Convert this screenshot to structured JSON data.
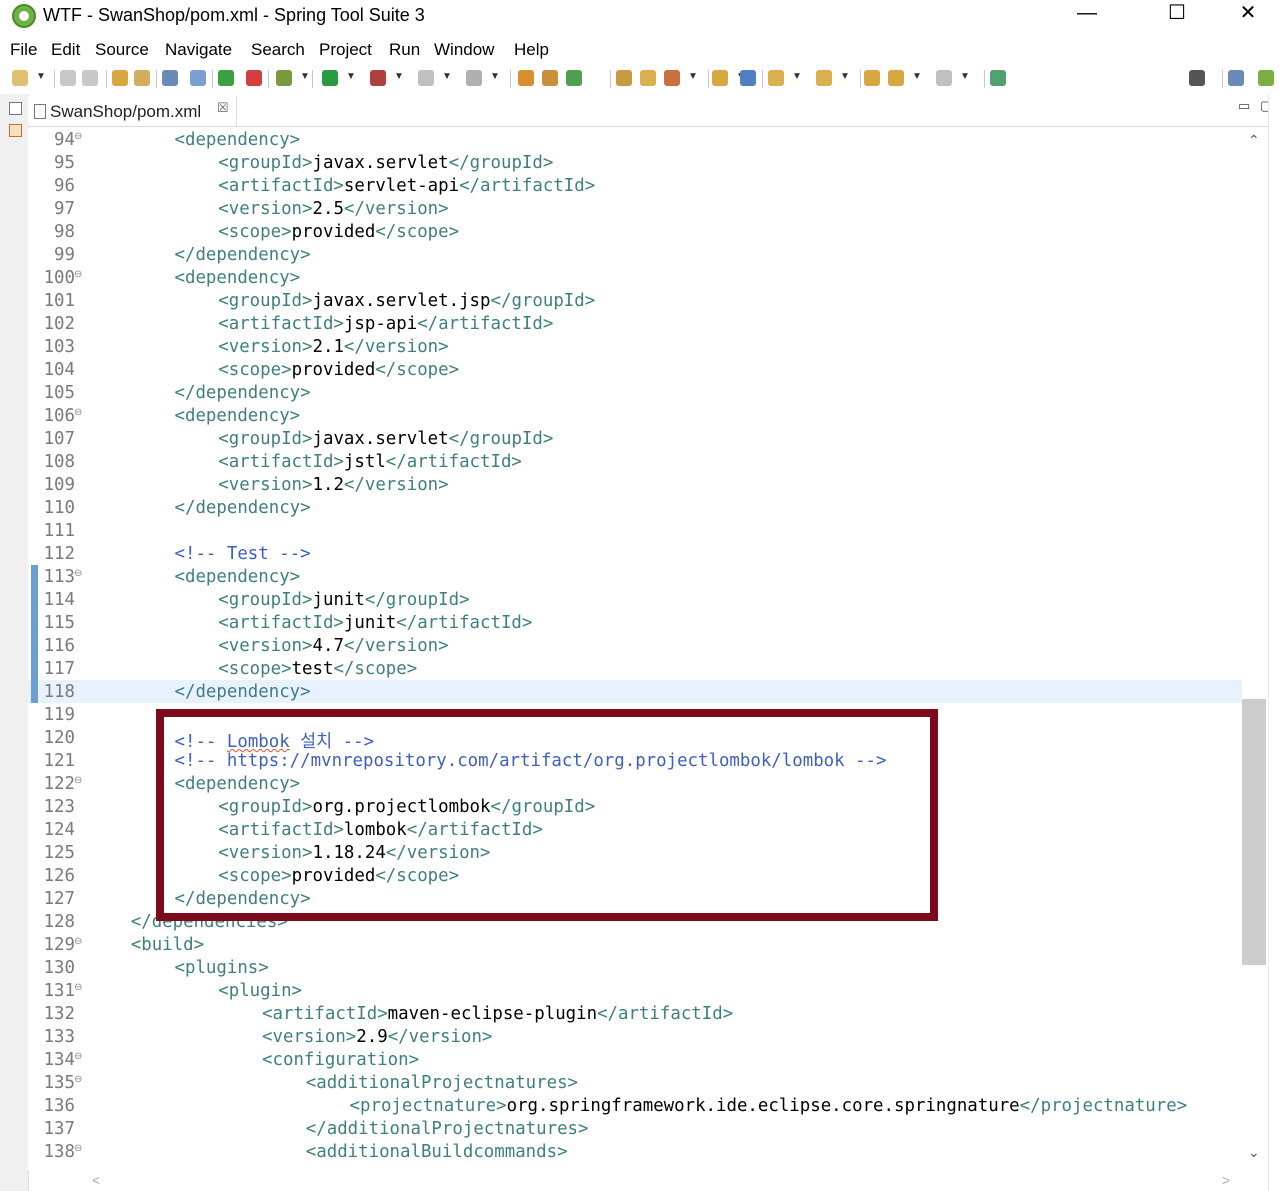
{
  "window": {
    "title": "WTF - SwanShop/pom.xml - Spring Tool Suite 3",
    "minimize_glyph": "—",
    "maximize_glyph": "☐",
    "close_glyph": "✕"
  },
  "menu": [
    "File",
    "Edit",
    "Source",
    "Navigate",
    "Search",
    "Project",
    "Run",
    "Window",
    "Help"
  ],
  "tab": {
    "label": "SwanShop/pom.xml",
    "close_glyph": "☒"
  },
  "view_controls": {
    "minimize_glyph": "▭",
    "maximize_glyph": "▢"
  },
  "scroll_glyphs": {
    "up": "⌃",
    "down": "⌄",
    "left": "<",
    "right": ">"
  },
  "editor": {
    "current_line": "118",
    "lines": [
      {
        "n": "94",
        "fold": "⊖",
        "indent": 8,
        "parts": [
          [
            "tag",
            "<dependency>"
          ]
        ]
      },
      {
        "n": "95",
        "fold": "",
        "indent": 12,
        "parts": [
          [
            "tag",
            "<groupId>"
          ],
          [
            "txt",
            "javax.servlet"
          ],
          [
            "tag",
            "</groupId>"
          ]
        ]
      },
      {
        "n": "96",
        "fold": "",
        "indent": 12,
        "parts": [
          [
            "tag",
            "<artifactId>"
          ],
          [
            "txt",
            "servlet-api"
          ],
          [
            "tag",
            "</artifactId>"
          ]
        ]
      },
      {
        "n": "97",
        "fold": "",
        "indent": 12,
        "parts": [
          [
            "tag",
            "<version>"
          ],
          [
            "txt",
            "2.5"
          ],
          [
            "tag",
            "</version>"
          ]
        ]
      },
      {
        "n": "98",
        "fold": "",
        "indent": 12,
        "parts": [
          [
            "tag",
            "<scope>"
          ],
          [
            "txt",
            "provided"
          ],
          [
            "tag",
            "</scope>"
          ]
        ]
      },
      {
        "n": "99",
        "fold": "",
        "indent": 8,
        "parts": [
          [
            "tag",
            "</dependency>"
          ]
        ]
      },
      {
        "n": "100",
        "fold": "⊖",
        "indent": 8,
        "parts": [
          [
            "tag",
            "<dependency>"
          ]
        ]
      },
      {
        "n": "101",
        "fold": "",
        "indent": 12,
        "parts": [
          [
            "tag",
            "<groupId>"
          ],
          [
            "txt",
            "javax.servlet.jsp"
          ],
          [
            "tag",
            "</groupId>"
          ]
        ]
      },
      {
        "n": "102",
        "fold": "",
        "indent": 12,
        "parts": [
          [
            "tag",
            "<artifactId>"
          ],
          [
            "txt",
            "jsp-api"
          ],
          [
            "tag",
            "</artifactId>"
          ]
        ]
      },
      {
        "n": "103",
        "fold": "",
        "indent": 12,
        "parts": [
          [
            "tag",
            "<version>"
          ],
          [
            "txt",
            "2.1"
          ],
          [
            "tag",
            "</version>"
          ]
        ]
      },
      {
        "n": "104",
        "fold": "",
        "indent": 12,
        "parts": [
          [
            "tag",
            "<scope>"
          ],
          [
            "txt",
            "provided"
          ],
          [
            "tag",
            "</scope>"
          ]
        ]
      },
      {
        "n": "105",
        "fold": "",
        "indent": 8,
        "parts": [
          [
            "tag",
            "</dependency>"
          ]
        ]
      },
      {
        "n": "106",
        "fold": "⊖",
        "indent": 8,
        "parts": [
          [
            "tag",
            "<dependency>"
          ]
        ]
      },
      {
        "n": "107",
        "fold": "",
        "indent": 12,
        "parts": [
          [
            "tag",
            "<groupId>"
          ],
          [
            "txt",
            "javax.servlet"
          ],
          [
            "tag",
            "</groupId>"
          ]
        ]
      },
      {
        "n": "108",
        "fold": "",
        "indent": 12,
        "parts": [
          [
            "tag",
            "<artifactId>"
          ],
          [
            "txt",
            "jstl"
          ],
          [
            "tag",
            "</artifactId>"
          ]
        ]
      },
      {
        "n": "109",
        "fold": "",
        "indent": 12,
        "parts": [
          [
            "tag",
            "<version>"
          ],
          [
            "txt",
            "1.2"
          ],
          [
            "tag",
            "</version>"
          ]
        ]
      },
      {
        "n": "110",
        "fold": "",
        "indent": 8,
        "parts": [
          [
            "tag",
            "</dependency>"
          ]
        ]
      },
      {
        "n": "111",
        "fold": "",
        "indent": 0,
        "parts": []
      },
      {
        "n": "112",
        "fold": "",
        "indent": 8,
        "parts": [
          [
            "cmt",
            "<!-- Test -->"
          ]
        ]
      },
      {
        "n": "113",
        "fold": "⊖",
        "indent": 8,
        "qdiff": true,
        "parts": [
          [
            "tag",
            "<dependency>"
          ]
        ]
      },
      {
        "n": "114",
        "fold": "",
        "indent": 12,
        "qdiff": true,
        "parts": [
          [
            "tag",
            "<groupId>"
          ],
          [
            "txt",
            "junit"
          ],
          [
            "tag",
            "</groupId>"
          ]
        ]
      },
      {
        "n": "115",
        "fold": "",
        "indent": 12,
        "qdiff": true,
        "parts": [
          [
            "tag",
            "<artifactId>"
          ],
          [
            "txt",
            "junit"
          ],
          [
            "tag",
            "</artifactId>"
          ]
        ]
      },
      {
        "n": "116",
        "fold": "",
        "indent": 12,
        "qdiff": true,
        "parts": [
          [
            "tag",
            "<version>"
          ],
          [
            "txt",
            "4.7"
          ],
          [
            "tag",
            "</version>"
          ]
        ]
      },
      {
        "n": "117",
        "fold": "",
        "indent": 12,
        "qdiff": true,
        "parts": [
          [
            "tag",
            "<scope>"
          ],
          [
            "txt",
            "test"
          ],
          [
            "tag",
            "</scope>"
          ]
        ]
      },
      {
        "n": "118",
        "fold": "",
        "indent": 8,
        "qdiff": true,
        "parts": [
          [
            "tag",
            "</dependency>"
          ]
        ]
      },
      {
        "n": "119",
        "fold": "",
        "indent": 0,
        "parts": []
      },
      {
        "n": "120",
        "fold": "",
        "indent": 8,
        "parts": [
          [
            "cmt",
            "<!-- "
          ],
          [
            "cmtsq",
            "Lombok"
          ],
          [
            "cmt",
            " 설치 -->"
          ]
        ]
      },
      {
        "n": "121",
        "fold": "",
        "indent": 8,
        "parts": [
          [
            "cmt",
            "<!-- https://mvnrepository.com/artifact/org.projectlombok/lombok -->"
          ]
        ]
      },
      {
        "n": "122",
        "fold": "⊖",
        "indent": 8,
        "parts": [
          [
            "tag",
            "<dependency>"
          ]
        ]
      },
      {
        "n": "123",
        "fold": "",
        "indent": 12,
        "parts": [
          [
            "tag",
            "<groupId>"
          ],
          [
            "txt",
            "org.projectlombok"
          ],
          [
            "tag",
            "</groupId>"
          ]
        ]
      },
      {
        "n": "124",
        "fold": "",
        "indent": 12,
        "parts": [
          [
            "tag",
            "<artifactId>"
          ],
          [
            "txt",
            "lombok"
          ],
          [
            "tag",
            "</artifactId>"
          ]
        ]
      },
      {
        "n": "125",
        "fold": "",
        "indent": 12,
        "parts": [
          [
            "tag",
            "<version>"
          ],
          [
            "txt",
            "1.18.24"
          ],
          [
            "tag",
            "</version>"
          ]
        ]
      },
      {
        "n": "126",
        "fold": "",
        "indent": 12,
        "parts": [
          [
            "tag",
            "<scope>"
          ],
          [
            "txt",
            "provided"
          ],
          [
            "tag",
            "</scope>"
          ]
        ]
      },
      {
        "n": "127",
        "fold": "",
        "indent": 8,
        "parts": [
          [
            "tag",
            "</dependency>"
          ]
        ]
      },
      {
        "n": "128",
        "fold": "",
        "indent": 4,
        "parts": [
          [
            "tag",
            "</dependencies>"
          ]
        ]
      },
      {
        "n": "129",
        "fold": "⊖",
        "indent": 4,
        "parts": [
          [
            "tag",
            "<build>"
          ]
        ]
      },
      {
        "n": "130",
        "fold": "",
        "indent": 8,
        "parts": [
          [
            "tag",
            "<plugins>"
          ]
        ]
      },
      {
        "n": "131",
        "fold": "⊖",
        "indent": 12,
        "parts": [
          [
            "tag",
            "<plugin>"
          ]
        ]
      },
      {
        "n": "132",
        "fold": "",
        "indent": 16,
        "parts": [
          [
            "tag",
            "<artifactId>"
          ],
          [
            "txt",
            "maven-eclipse-plugin"
          ],
          [
            "tag",
            "</artifactId>"
          ]
        ]
      },
      {
        "n": "133",
        "fold": "",
        "indent": 16,
        "parts": [
          [
            "tag",
            "<version>"
          ],
          [
            "txt",
            "2.9"
          ],
          [
            "tag",
            "</version>"
          ]
        ]
      },
      {
        "n": "134",
        "fold": "⊖",
        "indent": 16,
        "parts": [
          [
            "tag",
            "<configuration>"
          ]
        ]
      },
      {
        "n": "135",
        "fold": "⊖",
        "indent": 20,
        "parts": [
          [
            "tag",
            "<additionalProjectnatures>"
          ]
        ]
      },
      {
        "n": "136",
        "fold": "",
        "indent": 24,
        "parts": [
          [
            "tag",
            "<projectnature>"
          ],
          [
            "txt",
            "org.springframework.ide.eclipse.core.springnature"
          ],
          [
            "tag",
            "</projectnature>"
          ]
        ]
      },
      {
        "n": "137",
        "fold": "",
        "indent": 20,
        "parts": [
          [
            "tag",
            "</additionalProjectnatures>"
          ]
        ]
      },
      {
        "n": "138",
        "fold": "⊖",
        "indent": 20,
        "parts": [
          [
            "tag",
            "<additionalBuildcommands>"
          ]
        ]
      }
    ]
  },
  "toolbar_icons": [
    {
      "name": "new-wizard-icon",
      "color": "#e0c070"
    },
    {
      "name": "save-icon",
      "color": "#c8c8c8"
    },
    {
      "name": "save-all-icon",
      "color": "#c8c8c8"
    },
    {
      "name": "open-type-icon",
      "color": "#d8a840"
    },
    {
      "name": "open-task-icon",
      "color": "#d0b060"
    },
    {
      "name": "console-icon",
      "color": "#6a8ab8"
    },
    {
      "name": "skip-breakpoints-icon",
      "color": "#7aa0d0"
    },
    {
      "name": "spring-boot-icon",
      "color": "#3aa040"
    },
    {
      "name": "relaunch-icon",
      "color": "#d04040"
    },
    {
      "name": "debug-icon",
      "color": "#7a9a40"
    },
    {
      "name": "run-icon",
      "color": "#2a9a40"
    },
    {
      "name": "external-tools-icon",
      "color": "#b04040"
    },
    {
      "name": "stop-icon",
      "color": "#c0c0c0"
    },
    {
      "name": "server-icon",
      "color": "#b0b0b0"
    },
    {
      "name": "spring-project-icon",
      "color": "#d89030"
    },
    {
      "name": "package-icon",
      "color": "#c8903a"
    },
    {
      "name": "refresh-icon",
      "color": "#50a050"
    },
    {
      "name": "open-folder-icon",
      "color": "#c89a40"
    },
    {
      "name": "folder-icon",
      "color": "#d8b050"
    },
    {
      "name": "rocket-icon",
      "color": "#c87040"
    },
    {
      "name": "search-folder-icon",
      "color": "#d8a840"
    },
    {
      "name": "globe-icon",
      "color": "#5080c0"
    },
    {
      "name": "next-annotation-icon",
      "color": "#d8b050"
    },
    {
      "name": "prev-annotation-icon",
      "color": "#d8b050"
    },
    {
      "name": "last-edit-icon",
      "color": "#d8a840"
    },
    {
      "name": "back-icon",
      "color": "#d8a840"
    },
    {
      "name": "forward-icon",
      "color": "#c0c0c0"
    },
    {
      "name": "pin-editor-icon",
      "color": "#50a070"
    },
    {
      "name": "search-icon",
      "color": "#555555"
    },
    {
      "name": "open-perspective-icon",
      "color": "#6a8ab8"
    },
    {
      "name": "spring-perspective-icon",
      "color": "#7ab040"
    }
  ],
  "colors": {
    "tag": "#3f7f7f",
    "comment": "#3f5fbf",
    "text": "#000000",
    "line_number": "#7a7a7a",
    "current_line_bg": "#e8f2fe",
    "annotation_box": "#7d0a1c"
  }
}
